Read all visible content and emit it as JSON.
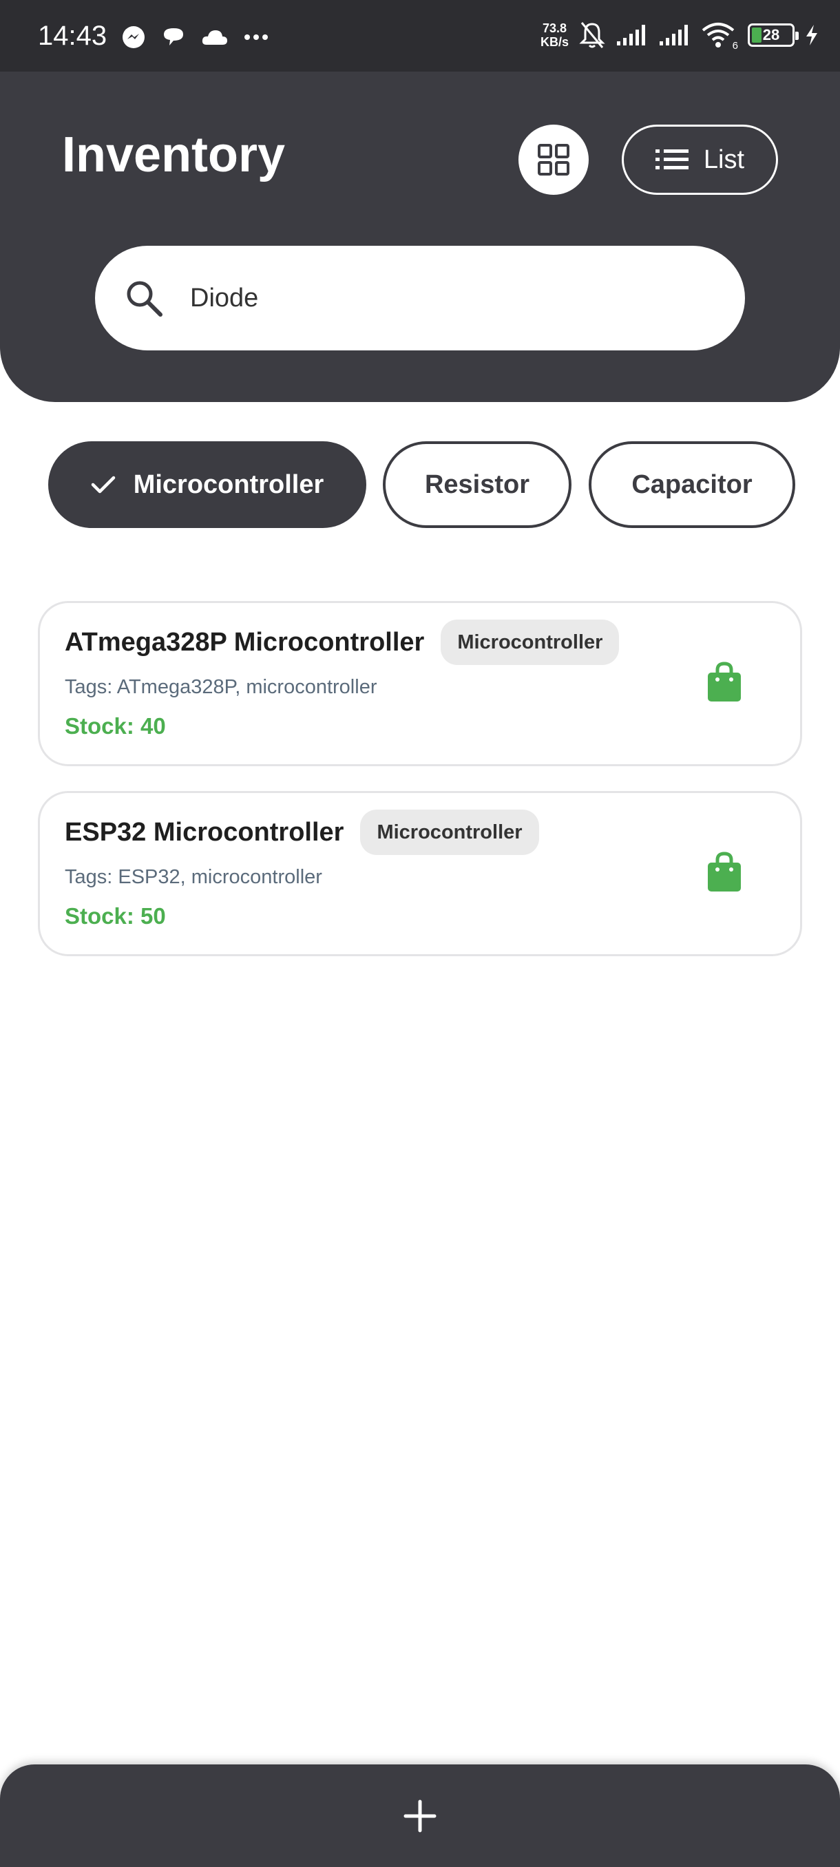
{
  "status_bar": {
    "time": "14:43",
    "network_speed_value": "73.8",
    "network_speed_unit": "KB/s",
    "wifi_label": "6",
    "battery_level": "28",
    "icons": [
      "messenger-icon",
      "chat-icon",
      "cloud-icon",
      "more-dots-icon",
      "bell-off-icon",
      "signal-icon",
      "signal-icon",
      "wifi-icon",
      "battery-icon",
      "charging-icon"
    ]
  },
  "header": {
    "title": "Inventory",
    "grid_view_icon": "grid-icon",
    "list_button_label": "List",
    "list_icon": "list-icon",
    "background_color": "#3c3c42"
  },
  "search": {
    "value": "Diode",
    "icon": "search-icon"
  },
  "filters": [
    {
      "label": "Microcontroller",
      "selected": true
    },
    {
      "label": "Resistor",
      "selected": false
    },
    {
      "label": "Capacitor",
      "selected": false
    }
  ],
  "items": [
    {
      "name": "ATmega328P Microcontroller",
      "category": "Microcontroller",
      "tags": "Tags: ATmega328P, microcontroller",
      "stock": "Stock: 40",
      "icon": "shopping-bag-icon"
    },
    {
      "name": "ESP32 Microcontroller",
      "category": "Microcontroller",
      "tags": "Tags: ESP32, microcontroller",
      "stock": "Stock: 50",
      "icon": "shopping-bag-icon"
    }
  ],
  "bottom_bar": {
    "add_icon": "plus-icon"
  },
  "colors": {
    "accent_dark": "#3c3c42",
    "stock_green": "#4caf50",
    "status_bar": "#2d2d31"
  }
}
